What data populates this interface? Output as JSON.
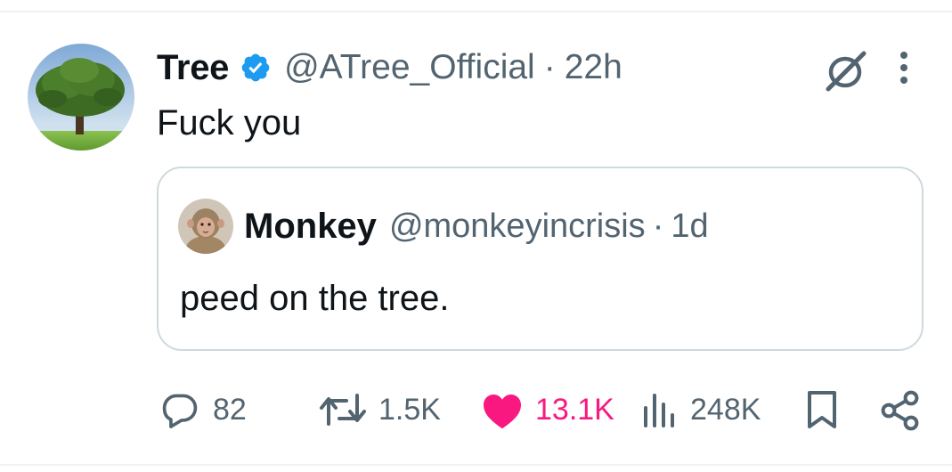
{
  "tweet": {
    "author": {
      "display_name": "Tree",
      "handle": "@ATree_Official",
      "verified": true,
      "avatar": "tree-photo"
    },
    "separator": "·",
    "time": "22h",
    "text": "Fuck you",
    "header_icons": [
      "grok-icon",
      "more-dots-icon"
    ]
  },
  "quote": {
    "author": {
      "display_name": "Monkey",
      "handle": "@monkeyincrisis",
      "avatar": "monkey-photo"
    },
    "separator": "·",
    "time": "1d",
    "text": "peed on the tree."
  },
  "actions": {
    "replies": "82",
    "reposts": "1.5K",
    "likes": "13.1K",
    "liked": true,
    "views": "248K",
    "bookmark_icon": "bookmark-icon",
    "share_icon": "share-icon"
  },
  "colors": {
    "text": "#0f1419",
    "secondary": "#536471",
    "verified": "#1d9bf0",
    "like": "#f91880",
    "border": "#cfd9de"
  }
}
